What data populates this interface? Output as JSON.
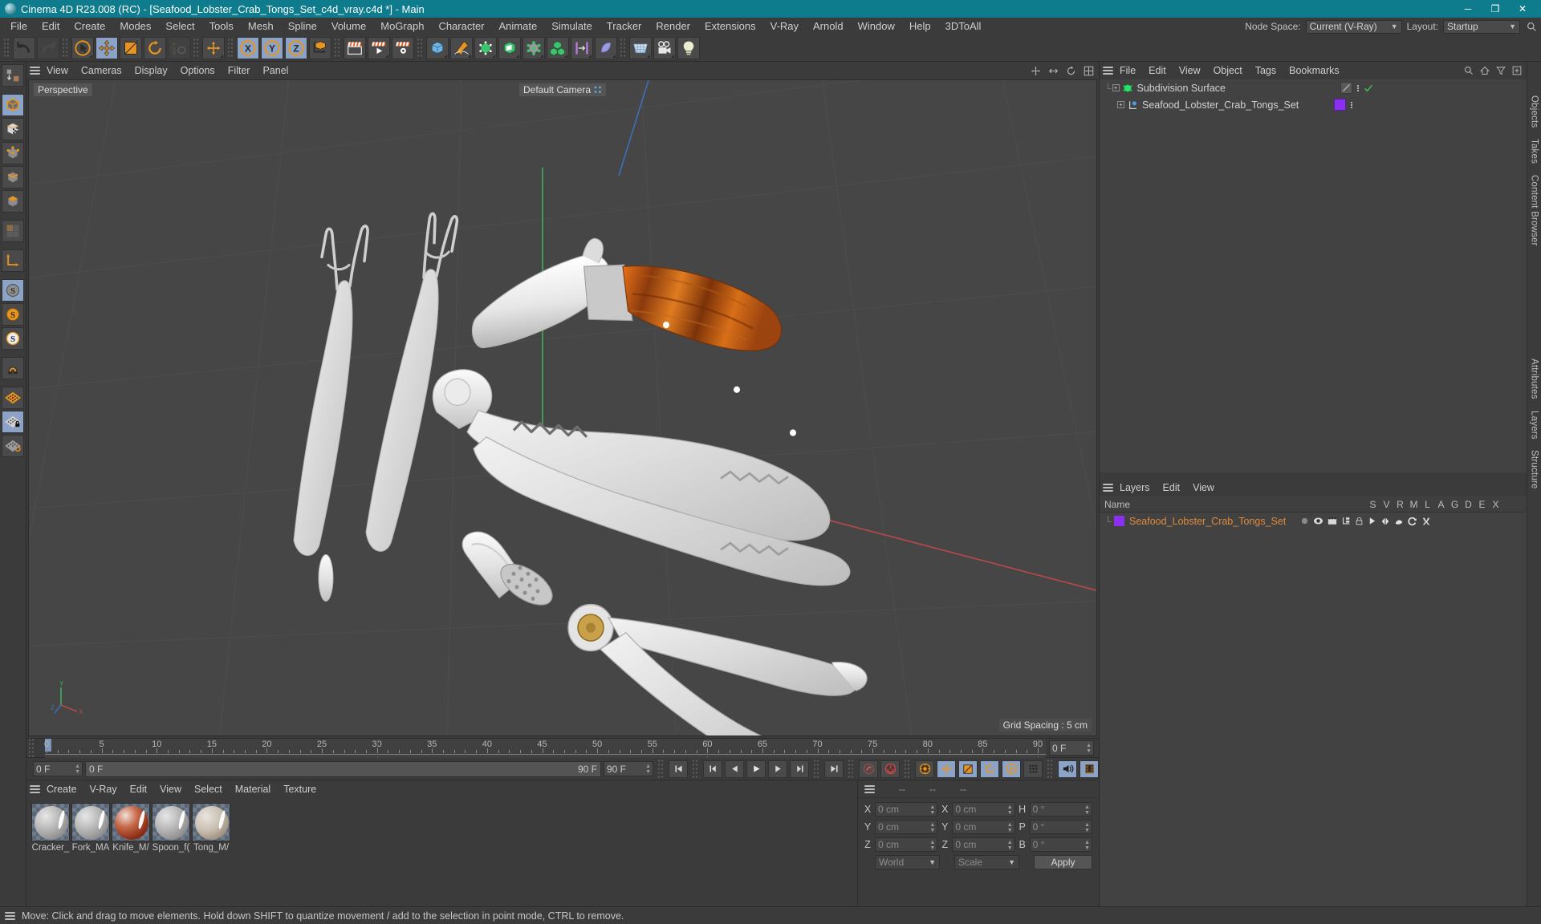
{
  "window": {
    "title": "Cinema 4D R23.008 (RC) - [Seafood_Lobster_Crab_Tongs_Set_c4d_vray.c4d *] - Main",
    "minimize": "─",
    "maximize": "❐",
    "close": "✕"
  },
  "menu": {
    "items": [
      "File",
      "Edit",
      "Create",
      "Modes",
      "Select",
      "Tools",
      "Mesh",
      "Spline",
      "Volume",
      "MoGraph",
      "Character",
      "Animate",
      "Simulate",
      "Tracker",
      "Render",
      "Extensions",
      "V-Ray",
      "Arnold",
      "Window",
      "Help",
      "3DToAll"
    ],
    "node_space_label": "Node Space:",
    "node_space_value": "Current (V-Ray)",
    "layout_label": "Layout:",
    "layout_value": "Startup",
    "search_icon": "search-icon"
  },
  "viewport": {
    "menu": [
      "View",
      "Cameras",
      "Display",
      "Options",
      "Filter",
      "Panel"
    ],
    "projection": "Perspective",
    "camera": "Default Camera",
    "grid_spacing": "Grid Spacing : 5 cm",
    "axis_labels": {
      "x": "X",
      "y": "Y",
      "z": "Z"
    }
  },
  "timeline": {
    "ticks": [
      "0",
      "5",
      "10",
      "15",
      "20",
      "25",
      "30",
      "35",
      "40",
      "45",
      "50",
      "55",
      "60",
      "65",
      "70",
      "75",
      "80",
      "85",
      "90"
    ],
    "current_frame_right": "0 F",
    "current_frame": "0 F",
    "range_start": "0 F",
    "range_end": "90 F",
    "end_frame": "90 F"
  },
  "materials": {
    "menu": [
      "Create",
      "V-Ray",
      "Edit",
      "View",
      "Select",
      "Material",
      "Texture"
    ],
    "items": [
      {
        "name": "Cracker_",
        "kind": "plain"
      },
      {
        "name": "Fork_MA",
        "kind": "plain"
      },
      {
        "name": "Knife_M/",
        "kind": "wood"
      },
      {
        "name": "Spoon_f(",
        "kind": "plain"
      },
      {
        "name": "Tong_M/",
        "kind": "speckle"
      }
    ]
  },
  "coordinates": {
    "header": [
      "--",
      "--",
      "--"
    ],
    "rows": [
      {
        "axis1": "X",
        "value1": "0 cm",
        "axis2": "X",
        "value2": "0 cm",
        "axis3": "H",
        "value3": "0 °"
      },
      {
        "axis1": "Y",
        "value1": "0 cm",
        "axis2": "Y",
        "value2": "0 cm",
        "axis3": "P",
        "value3": "0 °"
      },
      {
        "axis1": "Z",
        "value1": "0 cm",
        "axis2": "Z",
        "value2": "0 cm",
        "axis3": "B",
        "value3": "0 °"
      }
    ],
    "space": "World",
    "mode": "Scale",
    "apply": "Apply"
  },
  "object_manager": {
    "menu": [
      "File",
      "Edit",
      "View",
      "Object",
      "Tags",
      "Bookmarks"
    ],
    "rows": [
      {
        "label": "Subdivision Surface",
        "icon": "subdivision-surface-icon",
        "depth": 0
      },
      {
        "label": "Seafood_Lobster_Crab_Tongs_Set",
        "icon": "polygon-object-icon",
        "depth": 1
      }
    ],
    "tag_color": "#8b2ff0"
  },
  "layer_manager": {
    "menu": [
      "Layers",
      "Edit",
      "View"
    ],
    "name_column": "Name",
    "columns": [
      "S",
      "V",
      "R",
      "M",
      "L",
      "A",
      "G",
      "D",
      "E",
      "X"
    ],
    "rows": [
      {
        "label": "Seafood_Lobster_Crab_Tongs_Set",
        "color": "#8b2ff0"
      }
    ]
  },
  "right_tabs": [
    "Objects",
    "Takes",
    "Content Browser"
  ],
  "right_tabs_lower": [
    "Attributes",
    "Layers",
    "Structure"
  ],
  "statusbar": {
    "message": "Move: Click and drag to move elements. Hold down SHIFT to quantize movement / add to the selection in point mode, CTRL to remove."
  },
  "colors": {
    "title_bar": "#0e7c8c",
    "panel": "#3b3b3b",
    "viewport": "#464646",
    "accent_orange": "#e8941f",
    "selected_blue": "#8ba3c7",
    "layer_purple": "#8b2ff0",
    "layer_text": "#e08a3c"
  }
}
